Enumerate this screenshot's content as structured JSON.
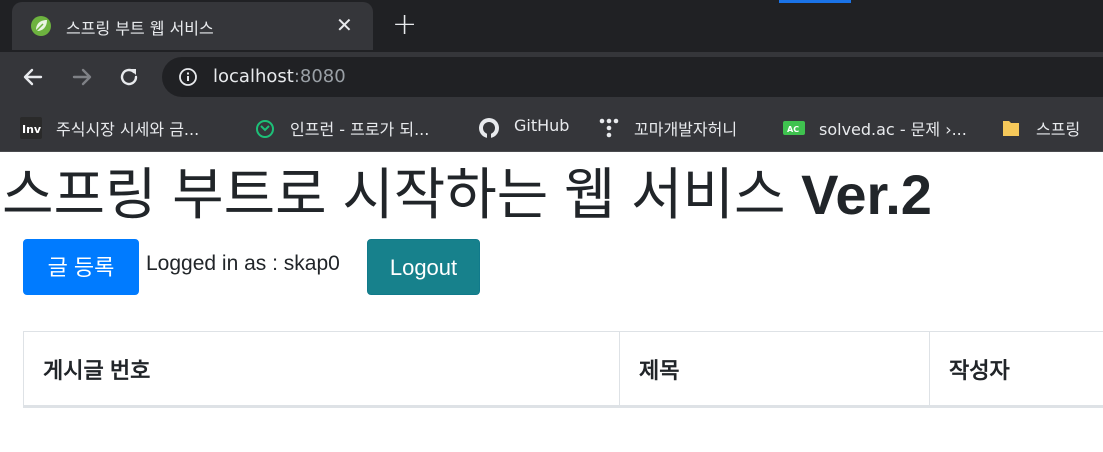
{
  "browser": {
    "tab": {
      "title": "스프링 부트 웹 서비스",
      "close": "✕",
      "new_tab": "+"
    },
    "address": {
      "host": "localhost",
      "port": ":8080"
    },
    "bookmarks": [
      {
        "label": "주식시장 시세와 금...",
        "icon": "investing-icon"
      },
      {
        "label": "인프런 - 프로가 되...",
        "icon": "inflearn-icon"
      },
      {
        "label": "GitHub",
        "icon": "github-icon"
      },
      {
        "label": "꼬마개발자허니",
        "icon": "tistory-icon"
      },
      {
        "label": "solved.ac - 문제 ›...",
        "icon": "solvedac-icon"
      },
      {
        "label": "스프링",
        "icon": "folder-icon"
      }
    ],
    "colors": {
      "chrome_dark": "#202124",
      "chrome_mid": "#35363a",
      "text": "#e8eaed"
    }
  },
  "page": {
    "title_main": "스프링 부트로 시작하는 웹 서비스",
    "title_ver": "Ver.2",
    "write_button": "글 등록",
    "login_text": "Logged in as : skap0",
    "logout_button": "Logout",
    "table": {
      "headers": [
        "게시글 번호",
        "제목",
        "작성자"
      ]
    },
    "colors": {
      "primary": "#007bff",
      "info": "#17818c",
      "text": "#212529"
    }
  }
}
